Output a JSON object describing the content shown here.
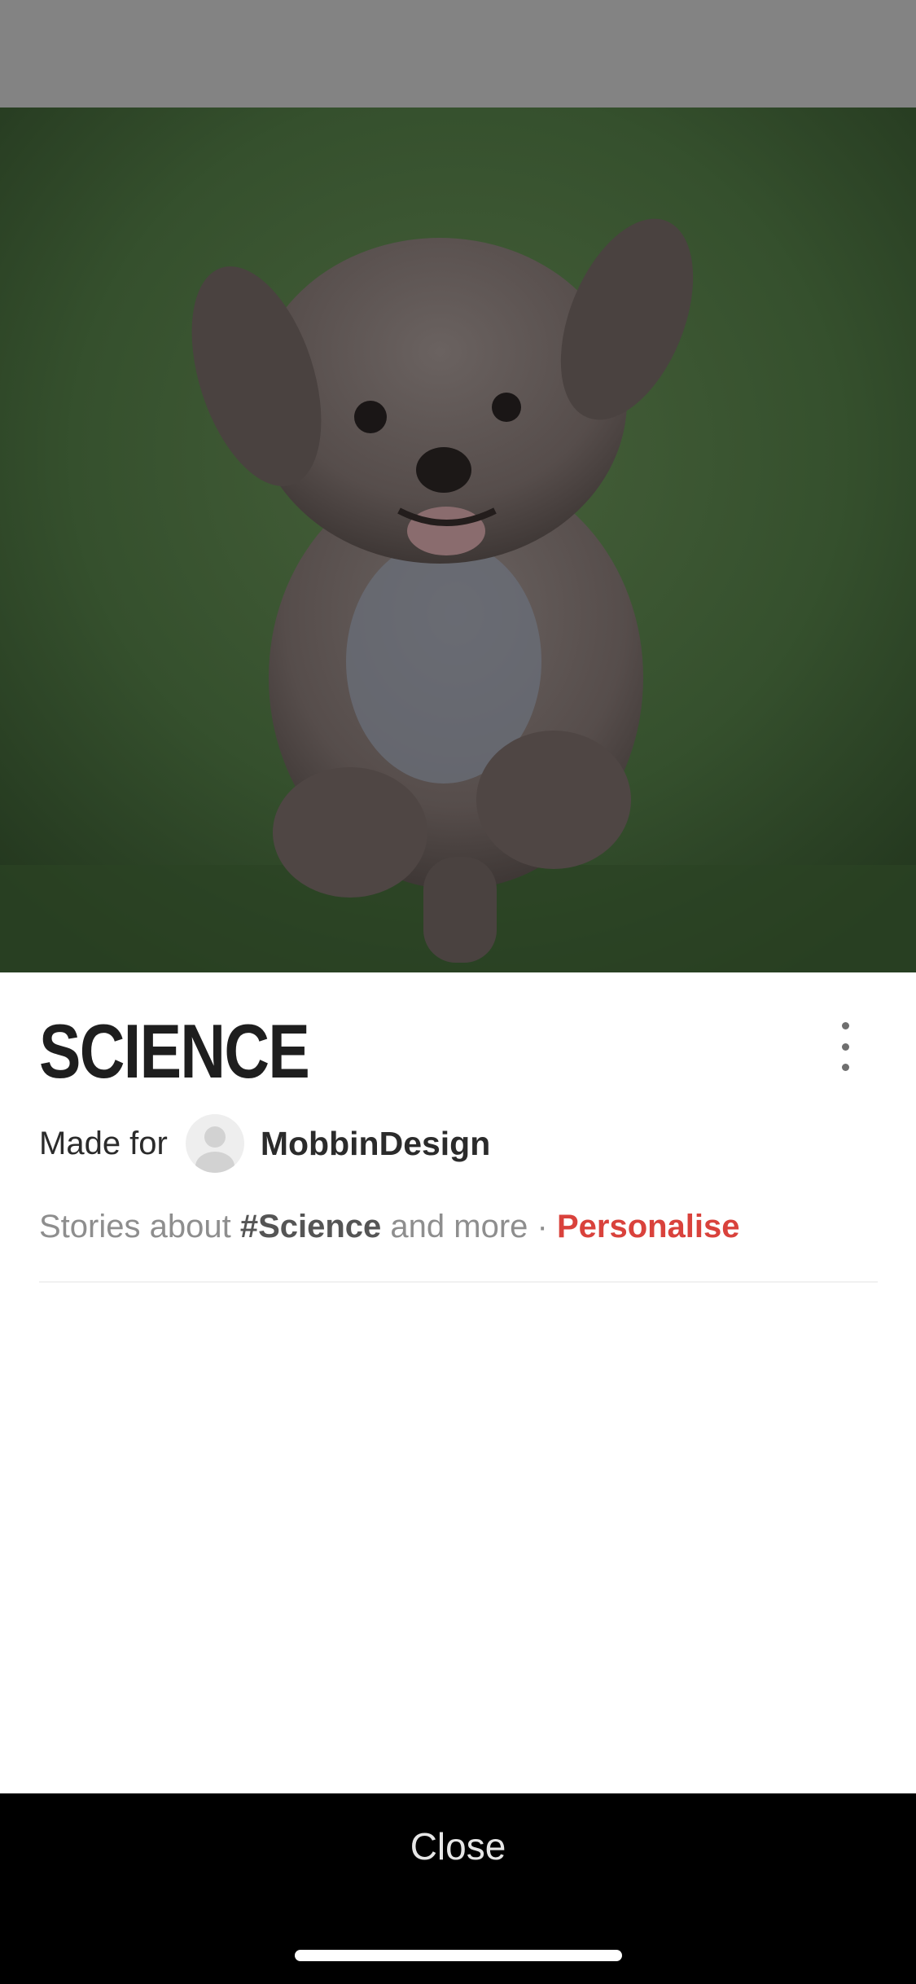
{
  "header": {
    "title": "SCIENCE",
    "more_icon": "more-vertical-icon"
  },
  "made_for": {
    "label": "Made for",
    "avatar_icon": "user-avatar-icon",
    "user_name": "MobbinDesign"
  },
  "description": {
    "prefix": "Stories about ",
    "tag": "#Science",
    "middle": " and more · ",
    "link": "Personalise"
  },
  "footer": {
    "close_label": "Close"
  },
  "colors": {
    "accent": "#d9423c",
    "title": "#1e1e1e",
    "muted": "#8e8e8e",
    "bottom_bar": "#000000"
  }
}
